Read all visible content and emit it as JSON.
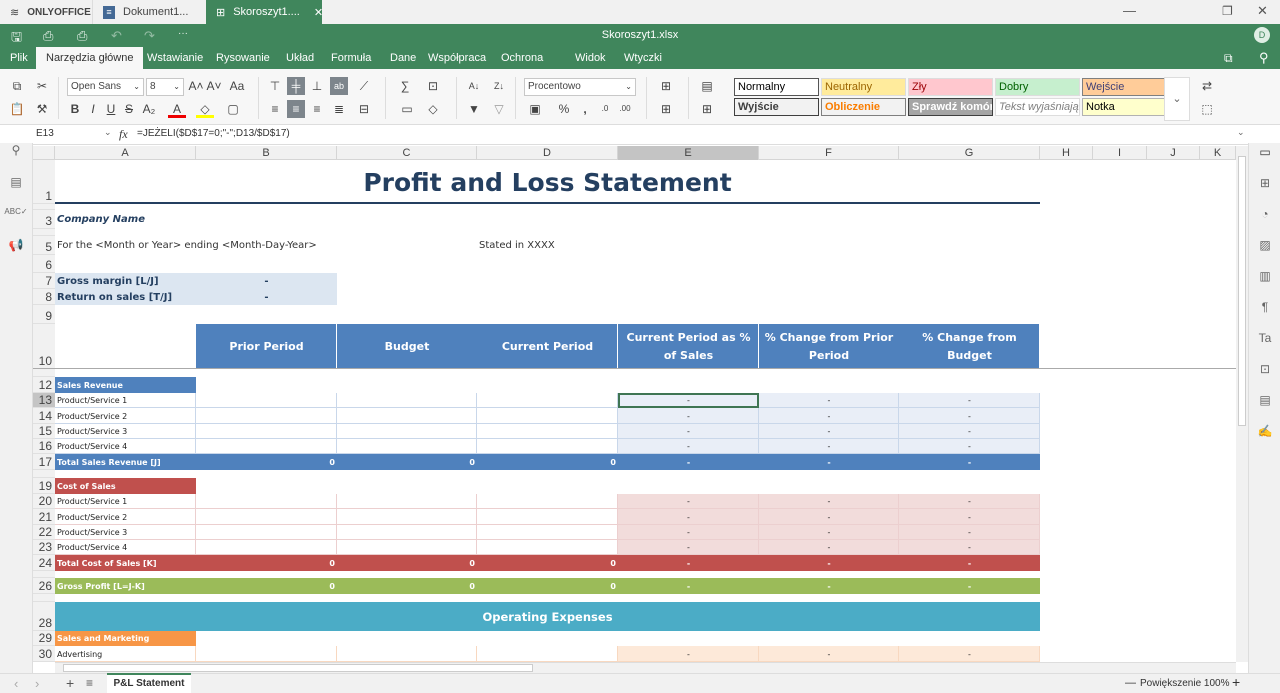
{
  "app": {
    "brand": "ONLYOFFICE",
    "tabs": [
      {
        "label": "Dokument1..."
      },
      {
        "label": "Skoroszyt1...."
      }
    ],
    "file_title": "Skoroszyt1.xlsx",
    "avatar": "D"
  },
  "colors": {
    "green": "#40865c",
    "blue": "#4f81bd",
    "red": "#c0504d",
    "olive": "#9bbb59",
    "teal": "#4bacc6",
    "orange": "#f79646",
    "title": "#243f60"
  },
  "menu": {
    "items": [
      {
        "label": "Plik"
      },
      {
        "label": "Narzędzia główne"
      },
      {
        "label": "Wstawianie"
      },
      {
        "label": "Rysowanie"
      },
      {
        "label": "Układ"
      },
      {
        "label": "Formuła"
      },
      {
        "label": "Dane"
      },
      {
        "label": "Współpraca"
      },
      {
        "label": "Ochrona"
      },
      {
        "label": "Widok"
      },
      {
        "label": "Wtyczki"
      }
    ],
    "active": "Narzędzia główne"
  },
  "toolbar": {
    "font_name": "Open Sans",
    "font_size": "8",
    "number_format": "Procentowo",
    "styles": [
      {
        "label": "Normalny"
      },
      {
        "label": "Neutralny"
      },
      {
        "label": "Zły"
      },
      {
        "label": "Dobry"
      },
      {
        "label": "Wejście"
      },
      {
        "label": "Wyjście"
      },
      {
        "label": "Obliczenie"
      },
      {
        "label": "Sprawdź komórkę"
      },
      {
        "label": "Tekst wyjaśniający"
      },
      {
        "label": "Notka"
      }
    ]
  },
  "formula_bar": {
    "cell_ref": "E13",
    "fx": "fx",
    "formula": "=JEŻELI($D$17=0;\"-\";D13/$D$17)"
  },
  "sheet": {
    "columns": [
      "A",
      "B",
      "C",
      "D",
      "E",
      "F",
      "G",
      "H",
      "I",
      "J",
      "K"
    ],
    "selected_cell": "E13",
    "rows": [
      {
        "n": "1",
        "style": "title",
        "cells": {
          "A": "Profit and Loss Statement"
        }
      },
      {
        "n": "",
        "style": "blank",
        "cells": {}
      },
      {
        "n": "3",
        "style": "company",
        "cells": {
          "A": "Company Name"
        }
      },
      {
        "n": "4",
        "style": "blank",
        "cells": {}
      },
      {
        "n": "5",
        "style": "subtitle",
        "cells": {
          "A": "For the <Month or Year> ending <Month-Day-Year>",
          "D": "Stated in XXXX"
        }
      },
      {
        "n": "6",
        "style": "blank",
        "cells": {}
      },
      {
        "n": "7",
        "style": "ratio",
        "cells": {
          "A": "Gross margin  [L/J]",
          "B": "-"
        }
      },
      {
        "n": "8",
        "style": "ratio",
        "cells": {
          "A": "Return on sales  [T/J]",
          "B": "-"
        }
      },
      {
        "n": "9",
        "style": "blank",
        "cells": {}
      },
      {
        "n": "10",
        "style": "colhead",
        "cells": {
          "B": "Prior Period",
          "C": "Budget",
          "D": "Current Period",
          "E": "Current Period as % of Sales",
          "F": "% Change from Prior Period",
          "G": "% Change from Budget"
        }
      },
      {
        "n": "11",
        "style": "blank",
        "cells": {}
      },
      {
        "n": "12",
        "style": "sec-blue",
        "cells": {
          "A": "Sales Revenue"
        }
      },
      {
        "n": "13",
        "style": "line-blue",
        "cells": {
          "A": "Product/Service 1",
          "E": "-",
          "F": "-",
          "G": "-"
        }
      },
      {
        "n": "14",
        "style": "line-blue",
        "cells": {
          "A": "Product/Service 2",
          "E": "-",
          "F": "-",
          "G": "-"
        }
      },
      {
        "n": "15",
        "style": "line-blue",
        "cells": {
          "A": "Product/Service 3",
          "E": "-",
          "F": "-",
          "G": "-"
        }
      },
      {
        "n": "16",
        "style": "line-blue",
        "cells": {
          "A": "Product/Service 4",
          "E": "-",
          "F": "-",
          "G": "-"
        }
      },
      {
        "n": "17",
        "style": "total-blue",
        "cells": {
          "A": "Total Sales Revenue  [J]",
          "B": "0",
          "C": "0",
          "D": "0",
          "E": "-",
          "F": "-",
          "G": "-"
        }
      },
      {
        "n": "18",
        "style": "blank",
        "cells": {}
      },
      {
        "n": "19",
        "style": "sec-red",
        "cells": {
          "A": "Cost of Sales"
        }
      },
      {
        "n": "20",
        "style": "line-red",
        "cells": {
          "A": "Product/Service 1",
          "E": "-",
          "F": "-",
          "G": "-"
        }
      },
      {
        "n": "21",
        "style": "line-red",
        "cells": {
          "A": "Product/Service 2",
          "E": "-",
          "F": "-",
          "G": "-"
        }
      },
      {
        "n": "22",
        "style": "line-red",
        "cells": {
          "A": "Product/Service 3",
          "E": "-",
          "F": "-",
          "G": "-"
        }
      },
      {
        "n": "23",
        "style": "line-red",
        "cells": {
          "A": "Product/Service 4",
          "E": "-",
          "F": "-",
          "G": "-"
        }
      },
      {
        "n": "24",
        "style": "total-red",
        "cells": {
          "A": "Total Cost of Sales  [K]",
          "B": "0",
          "C": "0",
          "D": "0",
          "E": "-",
          "F": "-",
          "G": "-"
        }
      },
      {
        "n": "25",
        "style": "blank",
        "cells": {}
      },
      {
        "n": "26",
        "style": "total-olive",
        "cells": {
          "A": "Gross Profit  [L=J-K]",
          "B": "0",
          "C": "0",
          "D": "0",
          "E": "-",
          "F": "-",
          "G": "-"
        }
      },
      {
        "n": "27",
        "style": "blank",
        "cells": {}
      },
      {
        "n": "28",
        "style": "banner",
        "cells": {
          "A": "Operating Expenses"
        }
      },
      {
        "n": "29",
        "style": "sec-orange",
        "cells": {
          "A": "Sales and Marketing"
        }
      },
      {
        "n": "30",
        "style": "line-orange",
        "cells": {
          "A": "Advertising",
          "E": "-",
          "F": "-",
          "G": "-"
        }
      }
    ]
  },
  "sheet_tabs": [
    {
      "label": "P&L Statement",
      "active": true
    }
  ],
  "status": {
    "zoom_label": "Powiększenie 100%"
  }
}
